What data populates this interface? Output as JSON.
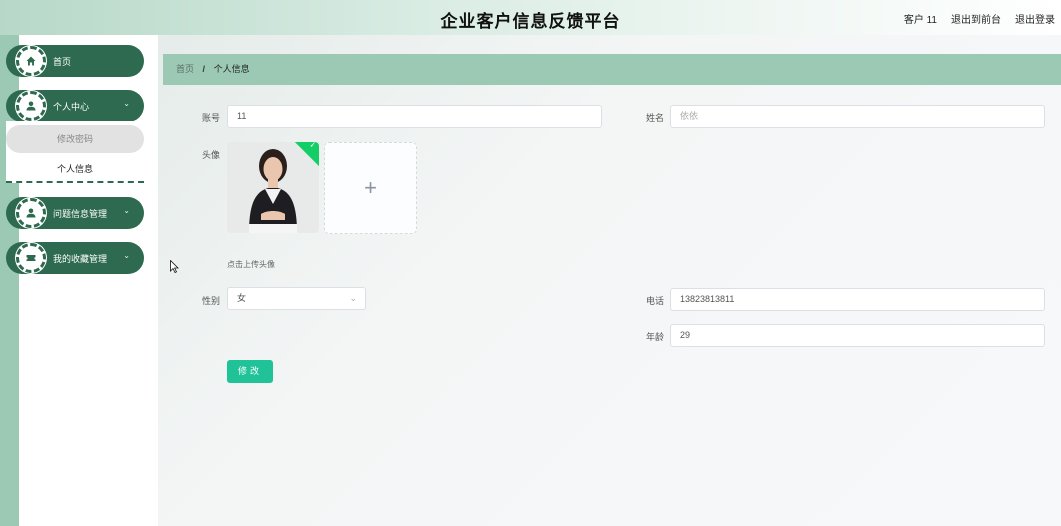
{
  "header": {
    "title": "企业客户信息反馈平台",
    "user": "客户 11",
    "back_label": "退出到前台",
    "logout_label": "退出登录"
  },
  "sidebar": {
    "items": [
      {
        "label": "首页",
        "icon": "home-icon",
        "chevron": ""
      },
      {
        "label": "个人中心",
        "icon": "user-icon",
        "chevron": "⌄"
      },
      {
        "label": "问题信息管理",
        "icon": "user-icon",
        "chevron": "⌄"
      },
      {
        "label": "我的收藏管理",
        "icon": "ticket-icon",
        "chevron": "⌄"
      }
    ],
    "submenu": {
      "change_password": "修改密码",
      "personal_info": "个人信息"
    }
  },
  "breadcrumb": {
    "home": "首页",
    "separator": "/",
    "current": "个人信息"
  },
  "form": {
    "account_label": "账号",
    "account_value": "11",
    "name_label": "姓名",
    "name_value": "依依",
    "avatar_label": "头像",
    "upload_tip": "点击上传头像",
    "gender_label": "性别",
    "gender_value": "女",
    "phone_label": "电话",
    "phone_value": "13823813811",
    "age_label": "年龄",
    "age_value": "29",
    "submit_label": "修改"
  },
  "colors": {
    "accent_dark": "#2d6a4f",
    "accent_light": "#9cc9b4",
    "submit": "#20c297"
  }
}
